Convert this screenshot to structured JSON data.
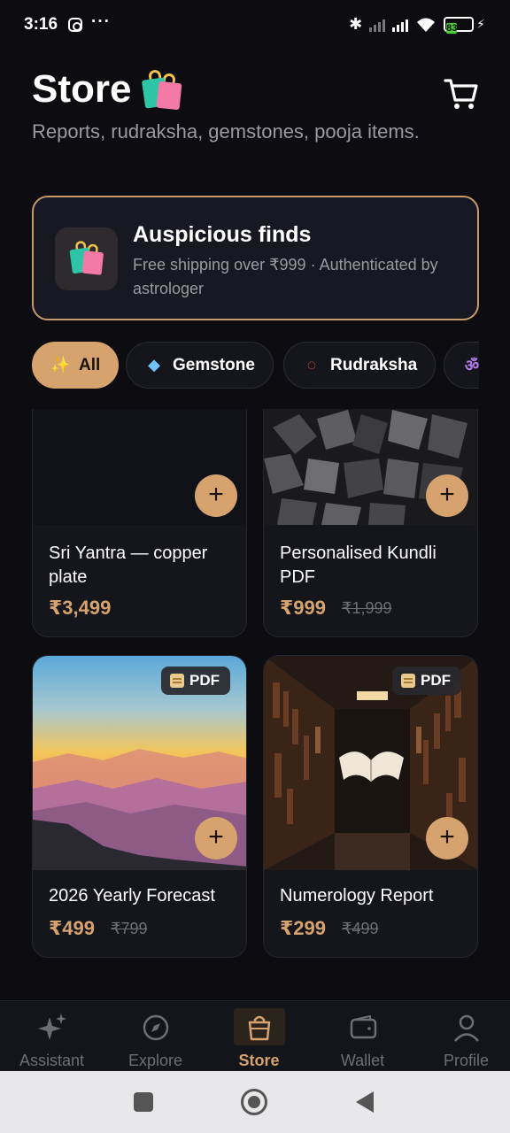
{
  "status_bar": {
    "time": "3:16",
    "dots": "···",
    "battery": "83"
  },
  "header": {
    "title": "Store",
    "subtitle": "Reports, rudraksha, gemstones, pooja items."
  },
  "promo": {
    "title": "Auspicious finds",
    "text": "Free shipping over ₹999 · Authenticated by astrologer"
  },
  "chips": [
    {
      "label": "All",
      "icon": "sparkles-icon",
      "active": true
    },
    {
      "label": "Gemstone",
      "icon": "gem-icon"
    },
    {
      "label": "Rudraksha",
      "icon": "beads-icon"
    },
    {
      "label": "",
      "icon": "om-icon"
    }
  ],
  "products": [
    {
      "name": "Sri Yantra — copper plate",
      "price": "₹3,499",
      "old_price": ""
    },
    {
      "name": "Personalised Kundli PDF",
      "price": "₹999",
      "old_price": "₹1,999"
    },
    {
      "name": "2026 Yearly Forecast",
      "price": "₹499",
      "old_price": "₹799",
      "badge": "PDF"
    },
    {
      "name": "Numerology Report",
      "price": "₹299",
      "old_price": "₹499",
      "badge": "PDF"
    }
  ],
  "add_symbol": "+",
  "nav": [
    {
      "label": "Assistant",
      "icon": "sparkles-icon"
    },
    {
      "label": "Explore",
      "icon": "compass-icon"
    },
    {
      "label": "Store",
      "icon": "bag-icon",
      "active": true
    },
    {
      "label": "Wallet",
      "icon": "wallet-icon"
    },
    {
      "label": "Profile",
      "icon": "person-icon"
    }
  ],
  "colors": {
    "accent": "#d6a36f",
    "background": "#0c0c11",
    "card": "#15151c"
  }
}
